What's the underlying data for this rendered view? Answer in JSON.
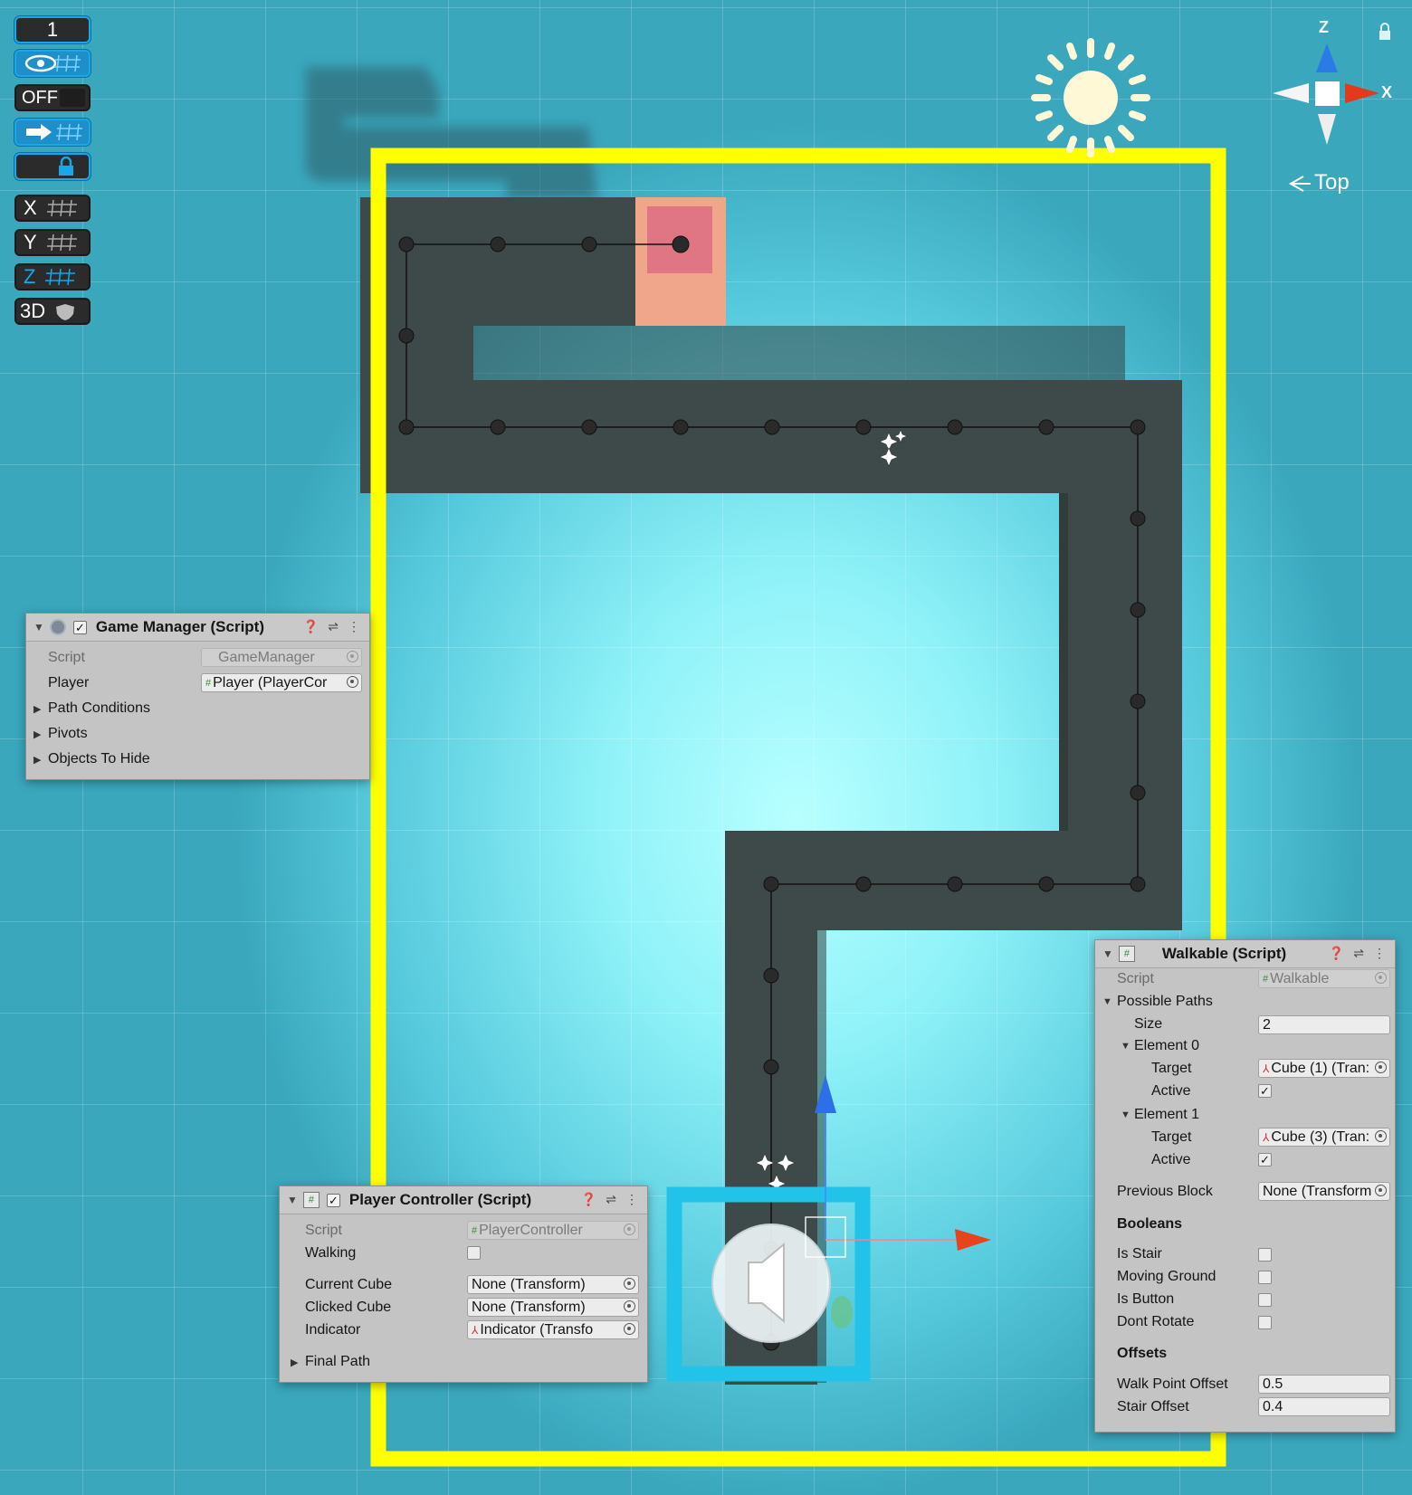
{
  "toolbar": {
    "layer_number": "1",
    "off_label": "OFF",
    "x_label": "X",
    "y_label": "Y",
    "z_label": "Z",
    "view3d_label": "3D"
  },
  "gizmo": {
    "axis_z": "Z",
    "axis_x": "X",
    "view_label": "Top"
  },
  "game_manager": {
    "title": "Game Manager (Script)",
    "script_label": "Script",
    "script_value": "GameManager",
    "player_label": "Player",
    "player_value": "Player (PlayerCor",
    "path_conditions": "Path Conditions",
    "pivots": "Pivots",
    "objects_to_hide": "Objects To Hide"
  },
  "player_controller": {
    "title": "Player Controller (Script)",
    "script_label": "Script",
    "script_value": "PlayerController",
    "walking_label": "Walking",
    "walking_checked": false,
    "current_cube_label": "Current Cube",
    "current_cube_value": "None (Transform)",
    "clicked_cube_label": "Clicked Cube",
    "clicked_cube_value": "None (Transform)",
    "indicator_label": "Indicator",
    "indicator_value": "Indicator (Transfo",
    "final_path_label": "Final Path"
  },
  "walkable": {
    "title": "Walkable (Script)",
    "script_label": "Script",
    "script_value": "Walkable",
    "possible_paths_label": "Possible Paths",
    "size_label": "Size",
    "size_value": "2",
    "element0_label": "Element 0",
    "element0_target_label": "Target",
    "element0_target_value": "Cube (1) (Tran:",
    "element0_active_label": "Active",
    "element1_label": "Element 1",
    "element1_target_label": "Target",
    "element1_target_value": "Cube (3) (Tran:",
    "element1_active_label": "Active",
    "previous_block_label": "Previous Block",
    "previous_block_value": "None (Transform",
    "booleans_label": "Booleans",
    "is_stair_label": "Is Stair",
    "moving_ground_label": "Moving Ground",
    "is_button_label": "Is Button",
    "dont_rotate_label": "Dont Rotate",
    "offsets_label": "Offsets",
    "walk_point_offset_label": "Walk Point Offset",
    "walk_point_offset_value": "0.5",
    "stair_offset_label": "Stair Offset",
    "stair_offset_value": "0.4"
  },
  "colors": {
    "selection_yellow": "#ffff00",
    "indicator_cyan": "#21c4e8",
    "path_dark": "#3d4a49",
    "target_block": "#e7808a"
  }
}
